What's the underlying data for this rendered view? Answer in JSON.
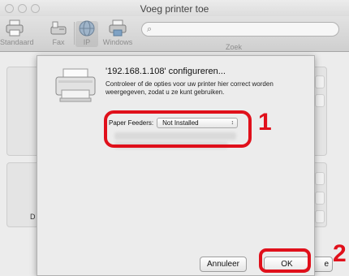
{
  "window": {
    "title": "Voeg printer toe",
    "toolbar": {
      "items": [
        {
          "label": "Standaard",
          "icon": "printer-icon"
        },
        {
          "label": "Fax",
          "icon": "fax-icon"
        },
        {
          "label": "IP",
          "icon": "globe-icon"
        },
        {
          "label": "Windows",
          "icon": "windows-printer-icon"
        }
      ],
      "search_label": "Zoek",
      "search_placeholder": ""
    },
    "background": {
      "right_button_partial": "e",
      "label_partial": "D"
    }
  },
  "dialog": {
    "title": "'192.168.1.108' configureren...",
    "description": "Controleer of de opties voor uw printer hier correct worden weergegeven, zodat u ze kunt gebruiken.",
    "option": {
      "label": "Paper Feeders:",
      "selected_value": "Not Installed"
    },
    "cancel_label": "Annuleer",
    "ok_label": "OK"
  },
  "annotations": {
    "callout_1": "1",
    "callout_2": "2",
    "color": "#e0101b"
  }
}
